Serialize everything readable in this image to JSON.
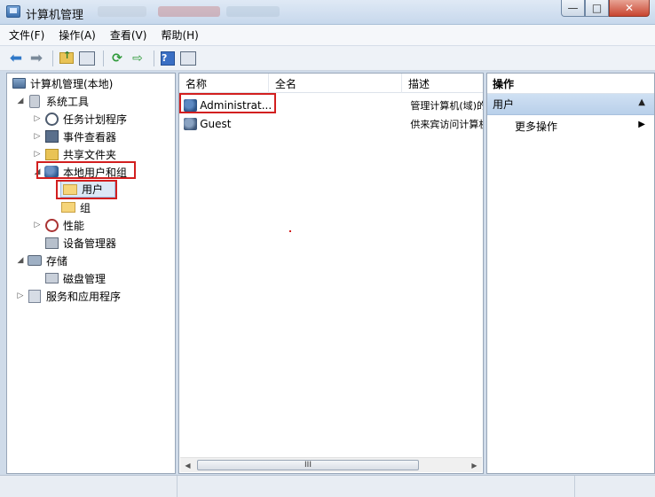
{
  "window": {
    "title": "计算机管理",
    "buttons": {
      "minimize": "—",
      "maximize": "□",
      "close": "✕"
    }
  },
  "menu": [
    "文件(F)",
    "操作(A)",
    "查看(V)",
    "帮助(H)"
  ],
  "tree": {
    "root": "计算机管理(本地)",
    "system_tools": "系统工具",
    "task_scheduler": "任务计划程序",
    "event_viewer": "事件查看器",
    "shared_folders": "共享文件夹",
    "local_users_groups": "本地用户和组",
    "users": "用户",
    "groups": "组",
    "performance": "性能",
    "device_manager": "设备管理器",
    "storage": "存储",
    "disk_management": "磁盘管理",
    "services_apps": "服务和应用程序"
  },
  "list": {
    "columns": [
      "名称",
      "全名",
      "描述"
    ],
    "rows": [
      {
        "name": "Administrat...",
        "fullname": "",
        "description": "管理计算机(域)的"
      },
      {
        "name": "Guest",
        "fullname": "",
        "description": "供来宾访问计算机"
      }
    ],
    "scroll_grip": "III"
  },
  "actions": {
    "title": "操作",
    "group": "用户",
    "more": "更多操作"
  },
  "highlight_color": "#d21f1f"
}
